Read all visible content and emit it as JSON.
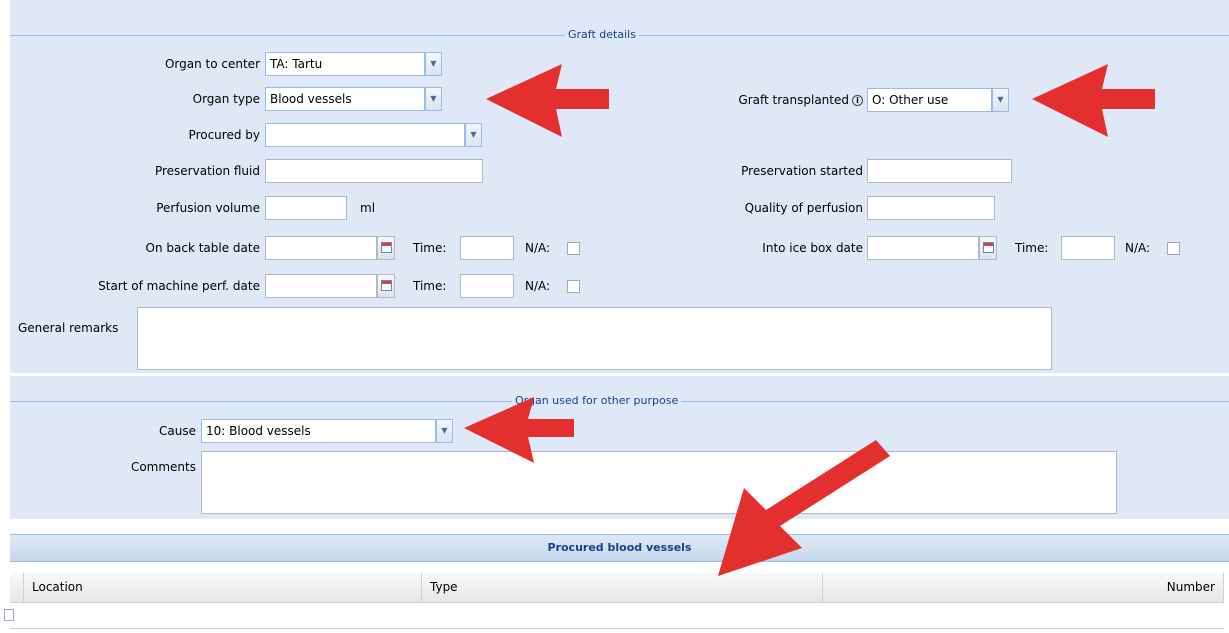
{
  "graft_details": {
    "legend": "Graft details",
    "organ_to_center": {
      "label": "Organ to center",
      "value": "TA: Tartu"
    },
    "organ_type": {
      "label": "Organ type",
      "value": "Blood vessels"
    },
    "procured_by": {
      "label": "Procured by",
      "value": ""
    },
    "preservation_fluid": {
      "label": "Preservation fluid",
      "value": ""
    },
    "perfusion_volume": {
      "label": "Perfusion volume",
      "value": "",
      "unit": "ml"
    },
    "on_back_table": {
      "label": "On back table date",
      "time_label": "Time:",
      "na_label": "N/A:"
    },
    "start_machine_perf": {
      "label": "Start of machine perf. date",
      "time_label": "Time:",
      "na_label": "N/A:"
    },
    "graft_transplanted": {
      "label": "Graft transplanted",
      "value": "O: Other use"
    },
    "preservation_started": {
      "label": "Preservation started",
      "value": ""
    },
    "quality_of_perfusion": {
      "label": "Quality of perfusion",
      "value": ""
    },
    "into_ice_box": {
      "label": "Into ice box date",
      "time_label": "Time:",
      "na_label": "N/A:"
    },
    "general_remarks": {
      "label": "General remarks",
      "value": ""
    }
  },
  "other_purpose": {
    "legend": "Organ used for other purpose",
    "cause": {
      "label": "Cause",
      "value": "10: Blood vessels"
    },
    "comments": {
      "label": "Comments",
      "value": ""
    }
  },
  "procured_blood_vessels": {
    "title": "Procured blood vessels",
    "columns": [
      "Location",
      "Type",
      "Number"
    ]
  },
  "colors": {
    "panel_bg": "#dfe8f6",
    "accent": "#15428b",
    "arrow": "#e3302f"
  }
}
